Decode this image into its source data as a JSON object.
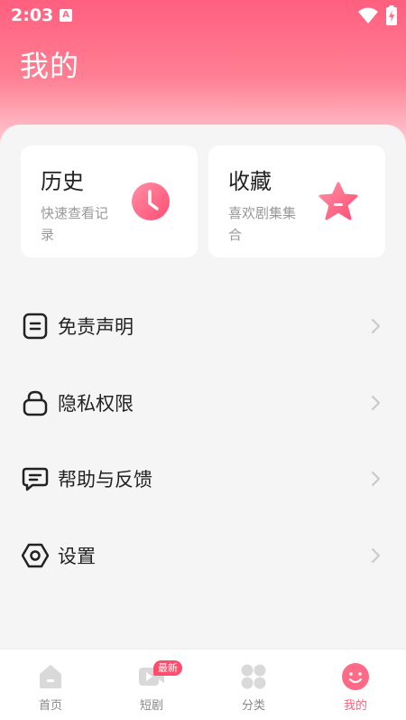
{
  "status_bar": {
    "time": "2:03",
    "notification_letter": "A"
  },
  "page_title": "我的",
  "cards": [
    {
      "title": "历史",
      "subtitle": "快速查看记录",
      "icon": "clock-icon"
    },
    {
      "title": "收藏",
      "subtitle": "喜欢剧集集合",
      "icon": "star-icon"
    }
  ],
  "menu": [
    {
      "label": "免责声明",
      "icon": "document-icon"
    },
    {
      "label": "隐私权限",
      "icon": "lock-icon"
    },
    {
      "label": "帮助与反馈",
      "icon": "message-icon"
    },
    {
      "label": "设置",
      "icon": "settings-icon"
    }
  ],
  "nav": [
    {
      "label": "首页",
      "icon": "home-icon",
      "active": false
    },
    {
      "label": "短剧",
      "icon": "video-icon",
      "active": false,
      "badge": "最新"
    },
    {
      "label": "分类",
      "icon": "grid-icon",
      "active": false
    },
    {
      "label": "我的",
      "icon": "profile-icon",
      "active": true
    }
  ],
  "colors": {
    "accent": "#ff5f7e",
    "card_bg": "#ffffff",
    "page_bg": "#f5f5f5"
  }
}
